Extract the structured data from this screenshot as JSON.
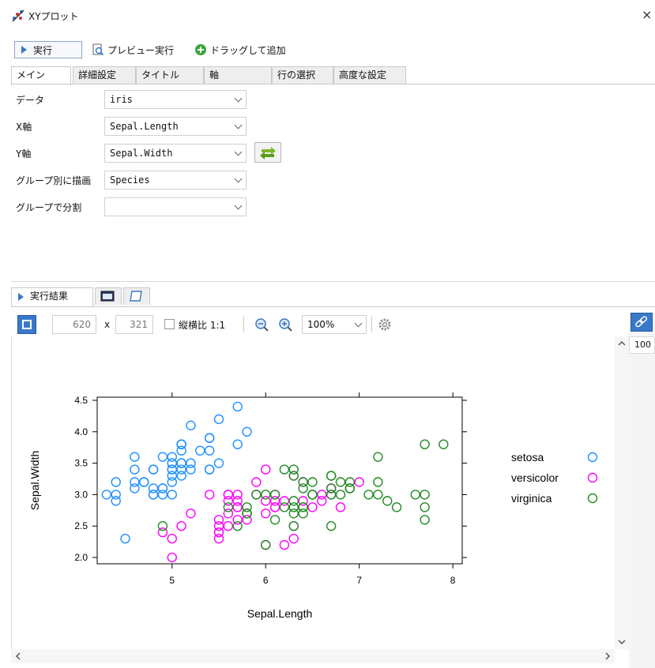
{
  "window": {
    "title": "XYプロット",
    "close": "×"
  },
  "toolbar": {
    "run": "実行",
    "preview": "プレビュー実行",
    "drag_add": "ドラッグして追加"
  },
  "tabs": [
    "メイン",
    "詳細設定",
    "タイトル",
    "軸",
    "行の選択",
    "高度な設定"
  ],
  "form": {
    "data_label": "データ",
    "data_value": "iris",
    "x_label": "X軸",
    "x_value": "Sepal.Length",
    "y_label": "Y軸",
    "y_value": "Sepal.Width",
    "group_label": "グループ別に描画",
    "group_value": "Species",
    "split_label": "グループで分割",
    "split_value": ""
  },
  "result_tabs": {
    "result": "実行結果"
  },
  "plot_toolbar": {
    "width": "620",
    "x": "x",
    "height": "321",
    "aspect": "縦横比 1:1",
    "zoom": "100%"
  },
  "right_panel": {
    "value": "100"
  },
  "chart_data": {
    "type": "scatter",
    "xlabel": "Sepal.Length",
    "ylabel": "Sepal.Width",
    "xlim": [
      4.2,
      8.1
    ],
    "ylim": [
      1.9,
      4.55
    ],
    "xticks": [
      5,
      6,
      7,
      8
    ],
    "yticks": [
      2.0,
      2.5,
      3.0,
      3.5,
      4.0,
      4.5
    ],
    "legend_position": "right",
    "series": [
      {
        "name": "setosa",
        "color": "#1e90ff",
        "points": [
          [
            5.1,
            3.5
          ],
          [
            4.9,
            3.0
          ],
          [
            4.7,
            3.2
          ],
          [
            4.6,
            3.1
          ],
          [
            5.0,
            3.6
          ],
          [
            5.4,
            3.9
          ],
          [
            4.6,
            3.4
          ],
          [
            5.0,
            3.4
          ],
          [
            4.4,
            2.9
          ],
          [
            4.9,
            3.1
          ],
          [
            5.4,
            3.7
          ],
          [
            4.8,
            3.4
          ],
          [
            4.8,
            3.0
          ],
          [
            4.3,
            3.0
          ],
          [
            5.8,
            4.0
          ],
          [
            5.7,
            4.4
          ],
          [
            5.4,
            3.9
          ],
          [
            5.1,
            3.5
          ],
          [
            5.7,
            3.8
          ],
          [
            5.1,
            3.8
          ],
          [
            5.4,
            3.4
          ],
          [
            5.1,
            3.7
          ],
          [
            4.6,
            3.6
          ],
          [
            5.1,
            3.3
          ],
          [
            4.8,
            3.4
          ],
          [
            5.0,
            3.0
          ],
          [
            5.0,
            3.4
          ],
          [
            5.2,
            3.5
          ],
          [
            5.2,
            3.4
          ],
          [
            4.7,
            3.2
          ],
          [
            4.8,
            3.1
          ],
          [
            5.4,
            3.4
          ],
          [
            5.2,
            4.1
          ],
          [
            5.5,
            4.2
          ],
          [
            4.9,
            3.1
          ],
          [
            5.0,
            3.2
          ],
          [
            5.5,
            3.5
          ],
          [
            4.9,
            3.6
          ],
          [
            4.4,
            3.0
          ],
          [
            5.1,
            3.4
          ],
          [
            5.0,
            3.5
          ],
          [
            4.5,
            2.3
          ],
          [
            4.4,
            3.2
          ],
          [
            5.0,
            3.5
          ],
          [
            5.1,
            3.8
          ],
          [
            4.8,
            3.0
          ],
          [
            5.1,
            3.8
          ],
          [
            4.6,
            3.2
          ],
          [
            5.3,
            3.7
          ],
          [
            5.0,
            3.3
          ]
        ]
      },
      {
        "name": "versicolor",
        "color": "#ff00ff",
        "points": [
          [
            7.0,
            3.2
          ],
          [
            6.4,
            3.2
          ],
          [
            6.9,
            3.1
          ],
          [
            5.5,
            2.3
          ],
          [
            6.5,
            2.8
          ],
          [
            5.7,
            2.8
          ],
          [
            6.3,
            3.3
          ],
          [
            4.9,
            2.4
          ],
          [
            6.6,
            2.9
          ],
          [
            5.2,
            2.7
          ],
          [
            5.0,
            2.0
          ],
          [
            5.9,
            3.0
          ],
          [
            6.0,
            2.2
          ],
          [
            6.1,
            2.9
          ],
          [
            5.6,
            2.9
          ],
          [
            6.7,
            3.1
          ],
          [
            5.6,
            3.0
          ],
          [
            5.8,
            2.7
          ],
          [
            6.2,
            2.2
          ],
          [
            5.6,
            2.5
          ],
          [
            5.9,
            3.2
          ],
          [
            6.1,
            2.8
          ],
          [
            6.3,
            2.5
          ],
          [
            6.1,
            2.8
          ],
          [
            6.4,
            2.9
          ],
          [
            6.6,
            3.0
          ],
          [
            6.8,
            2.8
          ],
          [
            6.7,
            3.0
          ],
          [
            6.0,
            2.9
          ],
          [
            5.7,
            2.6
          ],
          [
            5.5,
            2.4
          ],
          [
            5.5,
            2.4
          ],
          [
            5.8,
            2.7
          ],
          [
            6.0,
            2.7
          ],
          [
            5.4,
            3.0
          ],
          [
            6.0,
            3.4
          ],
          [
            6.7,
            3.1
          ],
          [
            6.3,
            2.3
          ],
          [
            5.6,
            3.0
          ],
          [
            5.5,
            2.5
          ],
          [
            5.5,
            2.6
          ],
          [
            6.1,
            3.0
          ],
          [
            5.8,
            2.6
          ],
          [
            5.0,
            2.3
          ],
          [
            5.6,
            2.7
          ],
          [
            5.7,
            3.0
          ],
          [
            5.7,
            2.9
          ],
          [
            6.2,
            2.9
          ],
          [
            5.1,
            2.5
          ],
          [
            5.7,
            2.8
          ]
        ]
      },
      {
        "name": "virginica",
        "color": "#228b22",
        "points": [
          [
            6.3,
            3.3
          ],
          [
            5.8,
            2.7
          ],
          [
            7.1,
            3.0
          ],
          [
            6.3,
            2.9
          ],
          [
            6.5,
            3.0
          ],
          [
            7.6,
            3.0
          ],
          [
            4.9,
            2.5
          ],
          [
            7.3,
            2.9
          ],
          [
            6.7,
            2.5
          ],
          [
            7.2,
            3.6
          ],
          [
            6.5,
            3.2
          ],
          [
            6.4,
            2.7
          ],
          [
            6.8,
            3.0
          ],
          [
            5.7,
            2.5
          ],
          [
            5.8,
            2.8
          ],
          [
            6.4,
            3.2
          ],
          [
            6.5,
            3.0
          ],
          [
            7.7,
            3.8
          ],
          [
            7.7,
            2.6
          ],
          [
            6.0,
            2.2
          ],
          [
            6.9,
            3.2
          ],
          [
            5.6,
            2.8
          ],
          [
            7.7,
            2.8
          ],
          [
            6.3,
            2.7
          ],
          [
            6.7,
            3.3
          ],
          [
            7.2,
            3.2
          ],
          [
            6.2,
            2.8
          ],
          [
            6.1,
            3.0
          ],
          [
            6.4,
            2.8
          ],
          [
            7.2,
            3.0
          ],
          [
            7.4,
            2.8
          ],
          [
            7.9,
            3.8
          ],
          [
            6.4,
            2.8
          ],
          [
            6.3,
            2.8
          ],
          [
            6.1,
            2.6
          ],
          [
            7.7,
            3.0
          ],
          [
            6.3,
            3.4
          ],
          [
            6.4,
            3.1
          ],
          [
            6.0,
            3.0
          ],
          [
            6.9,
            3.1
          ],
          [
            6.7,
            3.1
          ],
          [
            6.9,
            3.1
          ],
          [
            5.8,
            2.7
          ],
          [
            6.8,
            3.2
          ],
          [
            6.7,
            3.3
          ],
          [
            6.7,
            3.0
          ],
          [
            6.3,
            2.5
          ],
          [
            6.5,
            3.0
          ],
          [
            6.2,
            3.4
          ],
          [
            5.9,
            3.0
          ]
        ]
      }
    ]
  }
}
